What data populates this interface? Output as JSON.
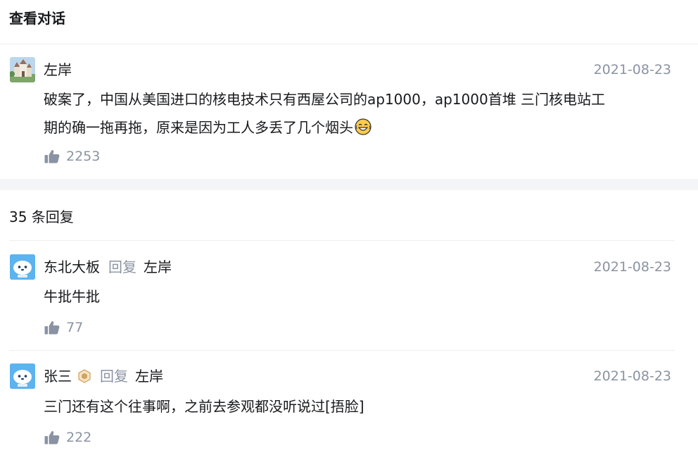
{
  "header": {
    "title": "查看对话"
  },
  "main_comment": {
    "author": "左岸",
    "date": "2021-08-23",
    "lines": [
      "破案了，中国从美国进口的核电技术只有西屋公司的ap1000，ap1000首堆 三门核电站工",
      "期的确一拖再拖，原来是因为工人多丢了几个烟头"
    ],
    "emoji": "laughing-tears-emoji",
    "likes": "2253"
  },
  "replies": {
    "count_label": "35 条回复",
    "reply_word": "回复",
    "items": [
      {
        "author": "东北大板",
        "reply_to": "左岸",
        "date": "2021-08-23",
        "content": "牛批牛批",
        "likes": "77",
        "badge": false
      },
      {
        "author": "张三",
        "reply_to": "左岸",
        "date": "2021-08-23",
        "content": "三门还有这个往事啊，之前去参观都没听说过[捂脸]",
        "likes": "222",
        "badge": true
      }
    ]
  },
  "icons": {
    "like": "thumbs-up-icon",
    "badge": "hexagon-badge-icon"
  },
  "colors": {
    "muted": "#8a93a3",
    "text": "#18191c",
    "gap": "#f4f5f7",
    "badge": "#d4a463"
  }
}
